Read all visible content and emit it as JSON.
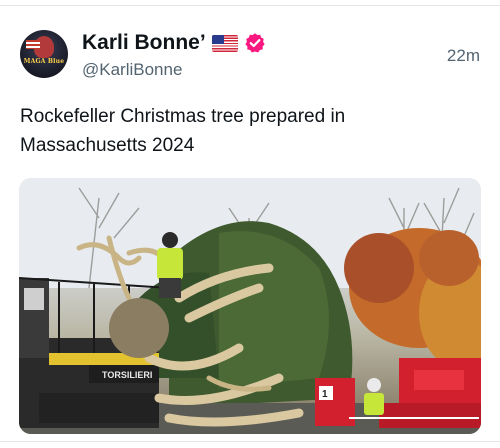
{
  "post": {
    "author": {
      "display_name": "Karli Bonne’",
      "flag_emoji": "🇺🇸",
      "verified_icon": "verified-badge-icon",
      "handle": "@KarliBonne",
      "avatar_text": "MAGA Blue"
    },
    "timestamp": "22m",
    "text": "Rockefeller Christmas tree prepared in Massachusetts 2024",
    "media": {
      "truck_label": "TORSILIERI",
      "machine_number": "1"
    }
  },
  "colors": {
    "verified_badge": "#f91880",
    "secondary_text": "#536471",
    "primary_text": "#0f1419",
    "machine_red": "#d2202f",
    "worker_vest": "#c6e63a"
  }
}
